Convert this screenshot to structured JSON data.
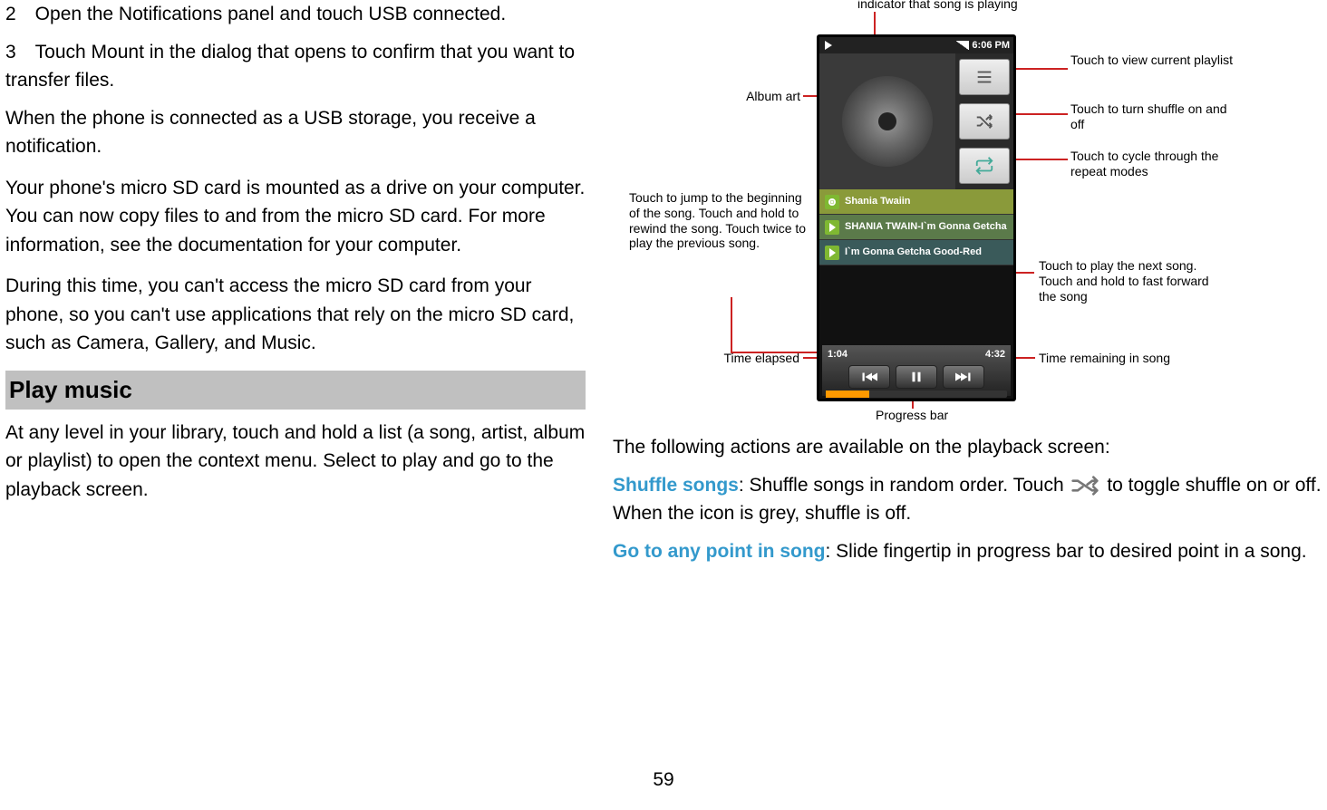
{
  "left": {
    "step2": "2 Open the Notifications panel and touch USB connected.",
    "step3": "3 Touch Mount in the dialog that opens to confirm that you want to transfer files.",
    "p1": "When the phone is connected as a USB storage, you receive a notification.",
    "p2": "Your phone's micro SD card is mounted as a drive on your computer. You can now copy files to and from the micro SD card. For more information, see the documentation for your computer.",
    "p3": "During this time, you can't access the micro SD card from your phone, so you can't use applications that rely on the micro SD card, such as Camera, Gallery, and Music.",
    "section_title": "Play music",
    "p4": "At any level in your library, touch and hold a list (a song, artist, album or playlist) to open the context menu. Select to play and go to the playback screen."
  },
  "diagram": {
    "statusbar_time": "6:06 PM",
    "track1": "Shania Twaiin",
    "track2": "SHANIA TWAIN-I`m Gonna Getcha",
    "track3": "I`m Gonna Getcha Good-Red",
    "time_elapsed": "1:04",
    "time_remaining": "4:32",
    "callouts": {
      "indicator": "indicator that song is playing",
      "album_art": "Album art",
      "jump": "Touch to jump to the beginning of the song. Touch and hold to rewind the song. Touch twice to play the previous song.",
      "elapsed": "Time elapsed",
      "playlist": "Touch  to view current playlist",
      "shuffle": "Touch to turn shuffle on and off",
      "repeat": "Touch to cycle through the repeat modes",
      "next": "Touch to play the next song. Touch and hold to fast forward the song",
      "remaining": "Time remaining in song",
      "progress": "Progress bar"
    }
  },
  "right": {
    "intro": "The following actions are available on the playback screen:",
    "shuffle_title": "Shuffle songs",
    "shuffle_text1": ": Shuffle songs in random order. Touch",
    "shuffle_text2": " to toggle shuffle on or off. When the icon is grey, shuffle is off.",
    "goto_title": "Go to any point in song",
    "goto_text": ": Slide fingertip in progress bar to desired point in a song."
  },
  "page": "59"
}
